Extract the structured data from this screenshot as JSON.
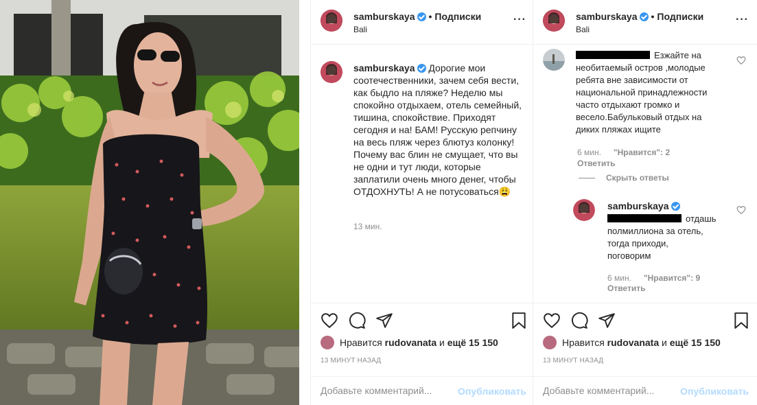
{
  "post": {
    "username": "samburskaya",
    "follow_label": "Подписки",
    "location": "Bali",
    "caption": "Дорогие мои соотечественники, зачем себя вести, как быдло на пляже? Неделю мы спокойно отдыхаем, отель семейный, тишина, спокойствие. Приходят сегодня и на! БАМ! Русскую репчину на весь пляж через блютуз колонку! Почему вас блин не смущает, что вы не одни и тут люди, которые заплатили очень много денег, чтобы ОТДОХНУТЬ! А не потусоваться",
    "caption_emoji": "😩",
    "caption_time": "13 мин."
  },
  "comments": {
    "first": {
      "text_lines": [
        "Езжайте на",
        "необитаемый остров ,молодые",
        "ребята вне зависимости от",
        "национальной принадлежности",
        "часто отдыхают громко и",
        "весело.Бабульковый отдых на",
        "диких пляжах ищите"
      ],
      "time": "6 мин.",
      "likes": "\"Нравится\": 2",
      "reply": "Ответить"
    },
    "hide_replies": "Скрыть ответы",
    "reply": {
      "username": "samburskaya",
      "text_lines": [
        "отдашь",
        "полмиллиона за отель,",
        "тогда приходи,",
        "поговорим"
      ],
      "time": "6 мин.",
      "likes": "\"Нравится\": 9",
      "reply": "Ответить"
    }
  },
  "footer": {
    "likes_prefix": "Нравится",
    "likes_user": "rudovanata",
    "likes_and": "и",
    "likes_more": "ещё 15 150",
    "ago": "13 МИНУТ НАЗАД",
    "comment_placeholder": "Добавьте комментарий...",
    "post_label": "Опубликовать"
  },
  "icons": {
    "like": "heart-icon",
    "comment": "comment-icon",
    "share": "share-icon",
    "save": "bookmark-icon",
    "more": "more-options-icon",
    "verified": "verified-badge-icon"
  },
  "colors": {
    "verified": "#3897f0",
    "secondary_text": "#8e8e8e",
    "post_button_disabled": "#b3dbff",
    "border": "#efefef"
  }
}
